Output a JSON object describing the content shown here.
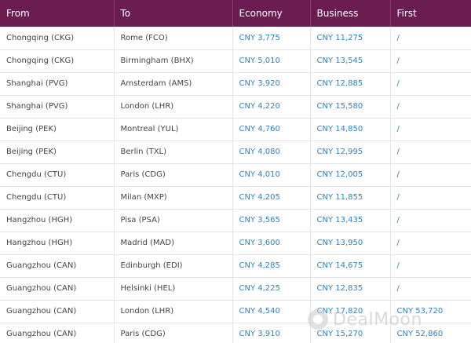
{
  "table": {
    "headers": [
      "From",
      "To",
      "Economy",
      "Business",
      "First"
    ],
    "rows": [
      {
        "from": "Chongqing (CKG)",
        "to": "Rome (FCO)",
        "economy": "CNY 3,775",
        "business": "CNY 11,275",
        "first": "/"
      },
      {
        "from": "Chongqing (CKG)",
        "to": "Birmingham (BHX)",
        "economy": "CNY 5,010",
        "business": "CNY 13,545",
        "first": "/"
      },
      {
        "from": "Shanghai (PVG)",
        "to": "Amsterdam (AMS)",
        "economy": "CNY 3,920",
        "business": "CNY 12,885",
        "first": "/"
      },
      {
        "from": "Shanghai (PVG)",
        "to": "London (LHR)",
        "economy": "CNY 4,220",
        "business": "CNY 15,580",
        "first": "/"
      },
      {
        "from": "Beijing (PEK)",
        "to": "Montreal (YUL)",
        "economy": "CNY 4,760",
        "business": "CNY 14,850",
        "first": "/"
      },
      {
        "from": "Beijing (PEK)",
        "to": "Berlin (TXL)",
        "economy": "CNY 4,080",
        "business": "CNY 12,995",
        "first": "/"
      },
      {
        "from": "Chengdu (CTU)",
        "to": "Paris (CDG)",
        "economy": "CNY 4,010",
        "business": "CNY 12,005",
        "first": "/"
      },
      {
        "from": "Chengdu (CTU)",
        "to": "Milan (MXP)",
        "economy": "CNY 4,205",
        "business": "CNY 11,855",
        "first": "/"
      },
      {
        "from": "Hangzhou (HGH)",
        "to": "Pisa (PSA)",
        "economy": "CNY 3,565",
        "business": "CNY 13,435",
        "first": "/"
      },
      {
        "from": "Hangzhou (HGH)",
        "to": "Madrid (MAD)",
        "economy": "CNY 3,600",
        "business": "CNY 13,950",
        "first": "/"
      },
      {
        "from": "Guangzhou (CAN)",
        "to": "Edinburgh (EDI)",
        "economy": "CNY 4,285",
        "business": "CNY 14,675",
        "first": "/"
      },
      {
        "from": "Guangzhou (CAN)",
        "to": "Helsinki (HEL)",
        "economy": "CNY 4,225",
        "business": "CNY 12,835",
        "first": "/"
      },
      {
        "from": "Guangzhou (CAN)",
        "to": "London (LHR)",
        "economy": "CNY 4,540",
        "business": "CNY 17,820",
        "first": "CNY 53,720"
      },
      {
        "from": "Guangzhou (CAN)",
        "to": "Paris (CDG)",
        "economy": "CNY 3,910",
        "business": "CNY 15,270",
        "first": "CNY 52,860"
      }
    ]
  },
  "watermark": {
    "text": "DealMoon",
    "icon": "dealmoon-logo-icon"
  },
  "colors": {
    "header_bg": "#6b1d52",
    "price_text": "#2f82c7",
    "body_text": "#444444"
  }
}
